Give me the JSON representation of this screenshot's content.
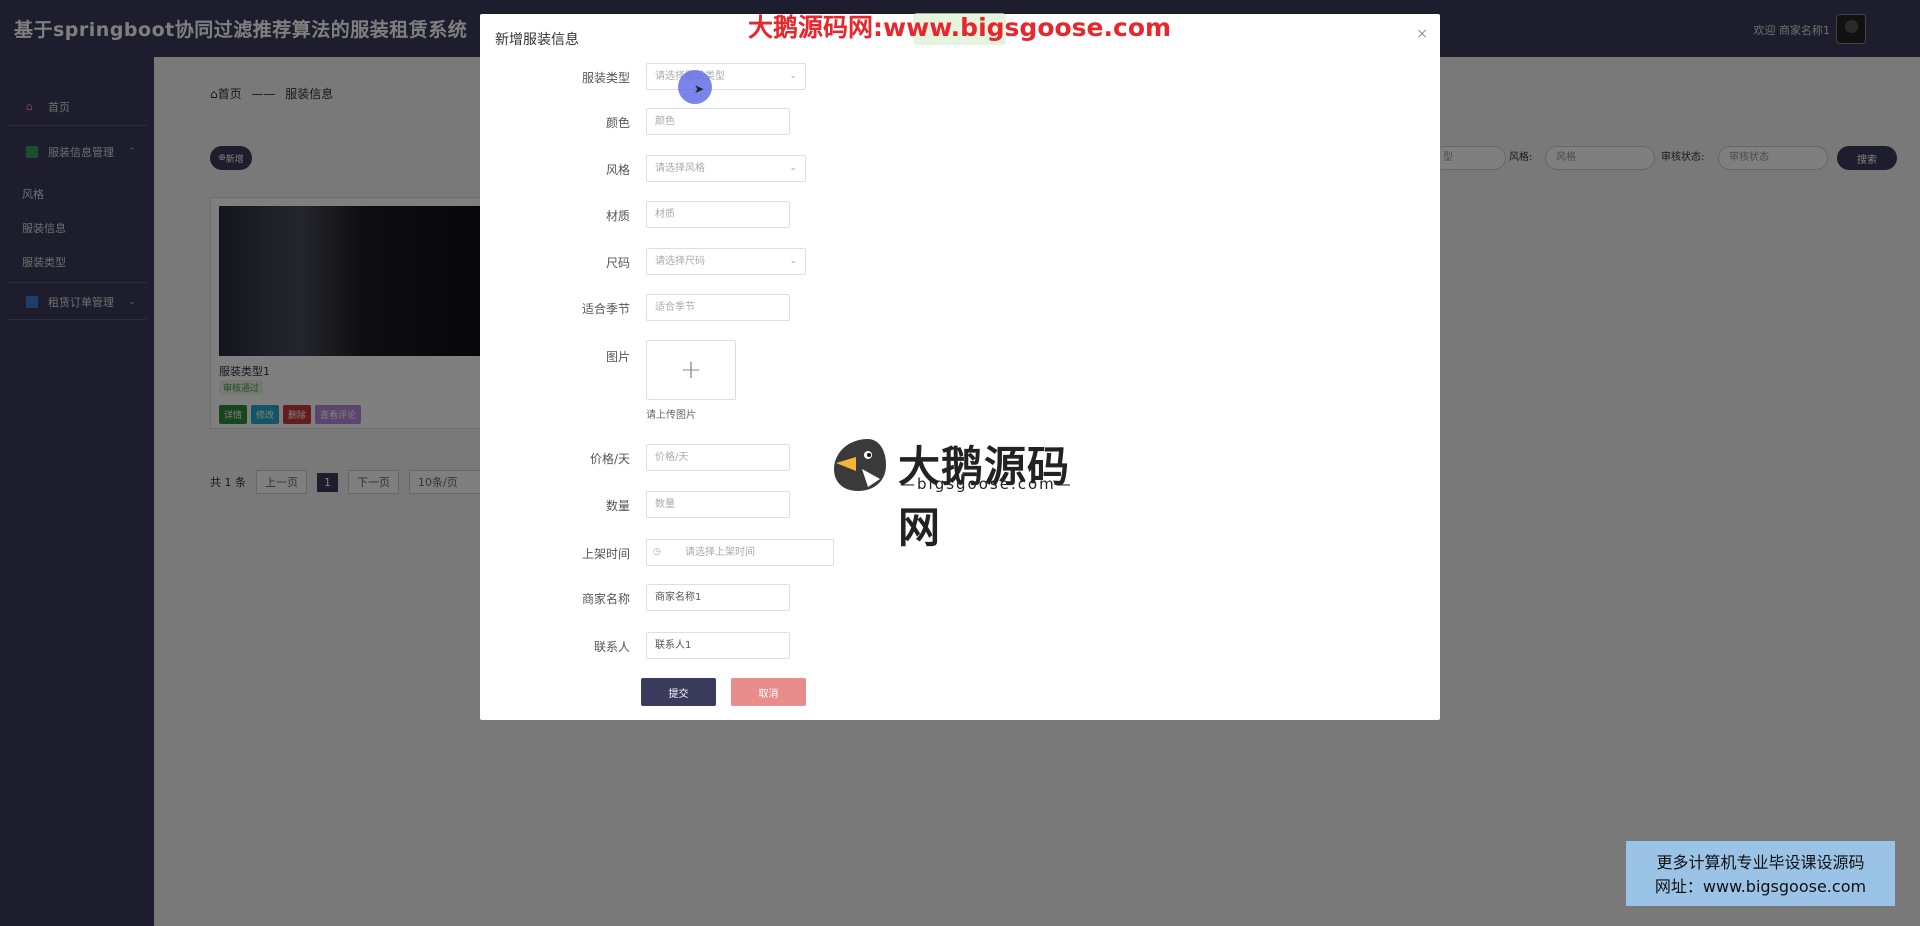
{
  "header": {
    "app_title": "基于springboot协同过滤推荐算法的服装租赁系统",
    "welcome": "欢迎 商家名称1"
  },
  "sidebar": {
    "items": [
      {
        "label": "首页"
      },
      {
        "label": "服装信息管理"
      },
      {
        "label": "风格"
      },
      {
        "label": "服装信息"
      },
      {
        "label": "服装类型"
      },
      {
        "label": "租赁订单管理"
      }
    ]
  },
  "breadcrumb": {
    "home": "首页",
    "sep": "——",
    "current": "服装信息"
  },
  "toolbar": {
    "add_label": "新增",
    "filter_style_label": "风格:",
    "filter_style_placeholder": "风格",
    "filter_audit_label": "审核状态:",
    "filter_audit_placeholder": "审核状态",
    "filter_type_placeholder": "型",
    "search_label": "搜索"
  },
  "card": {
    "name": "服装类型1",
    "status": "审核通过",
    "buttons": {
      "detail": "详情",
      "edit": "修改",
      "delete": "删除",
      "comment": "查看评论"
    }
  },
  "pager": {
    "total": "共 1 条",
    "prev": "上一页",
    "current": "1",
    "next": "下一页",
    "page_size": "10条/页"
  },
  "dialog": {
    "title": "新增服装信息",
    "close": "×",
    "fields": {
      "type": {
        "label": "服装类型",
        "placeholder": "请选择服装类型"
      },
      "color": {
        "label": "颜色",
        "placeholder": "颜色"
      },
      "style": {
        "label": "风格",
        "placeholder": "请选择风格"
      },
      "material": {
        "label": "材质",
        "placeholder": "材质"
      },
      "size": {
        "label": "尺码",
        "placeholder": "请选择尺码"
      },
      "season": {
        "label": "适合季节",
        "placeholder": "适合季节"
      },
      "image": {
        "label": "图片",
        "hint": "请上传图片",
        "plus": "+"
      },
      "price": {
        "label": "价格/天",
        "placeholder": "价格/天"
      },
      "quantity": {
        "label": "数量",
        "placeholder": "数量"
      },
      "listed_time": {
        "label": "上架时间",
        "placeholder": "请选择上架时间"
      },
      "merchant": {
        "label": "商家名称",
        "value": "商家名称1"
      },
      "contact": {
        "label": "联系人",
        "value": "联系人1"
      }
    },
    "submit_label": "提交",
    "cancel_label": "取消"
  },
  "watermarks": {
    "top": "大鹅源码网:www.bigsgoose.com",
    "center_big": "大鹅源码网",
    "center_small": "—bigsgoose.com—",
    "box_line1": "更多计算机专业毕设课设源码",
    "box_line2": "网址：www.bigsgoose.com"
  },
  "colors": {
    "primary": "#3a3a5c",
    "cancel": "#e88c8c",
    "watermark_red": "#e8262b",
    "watermark_box": "#9ac3e6"
  }
}
